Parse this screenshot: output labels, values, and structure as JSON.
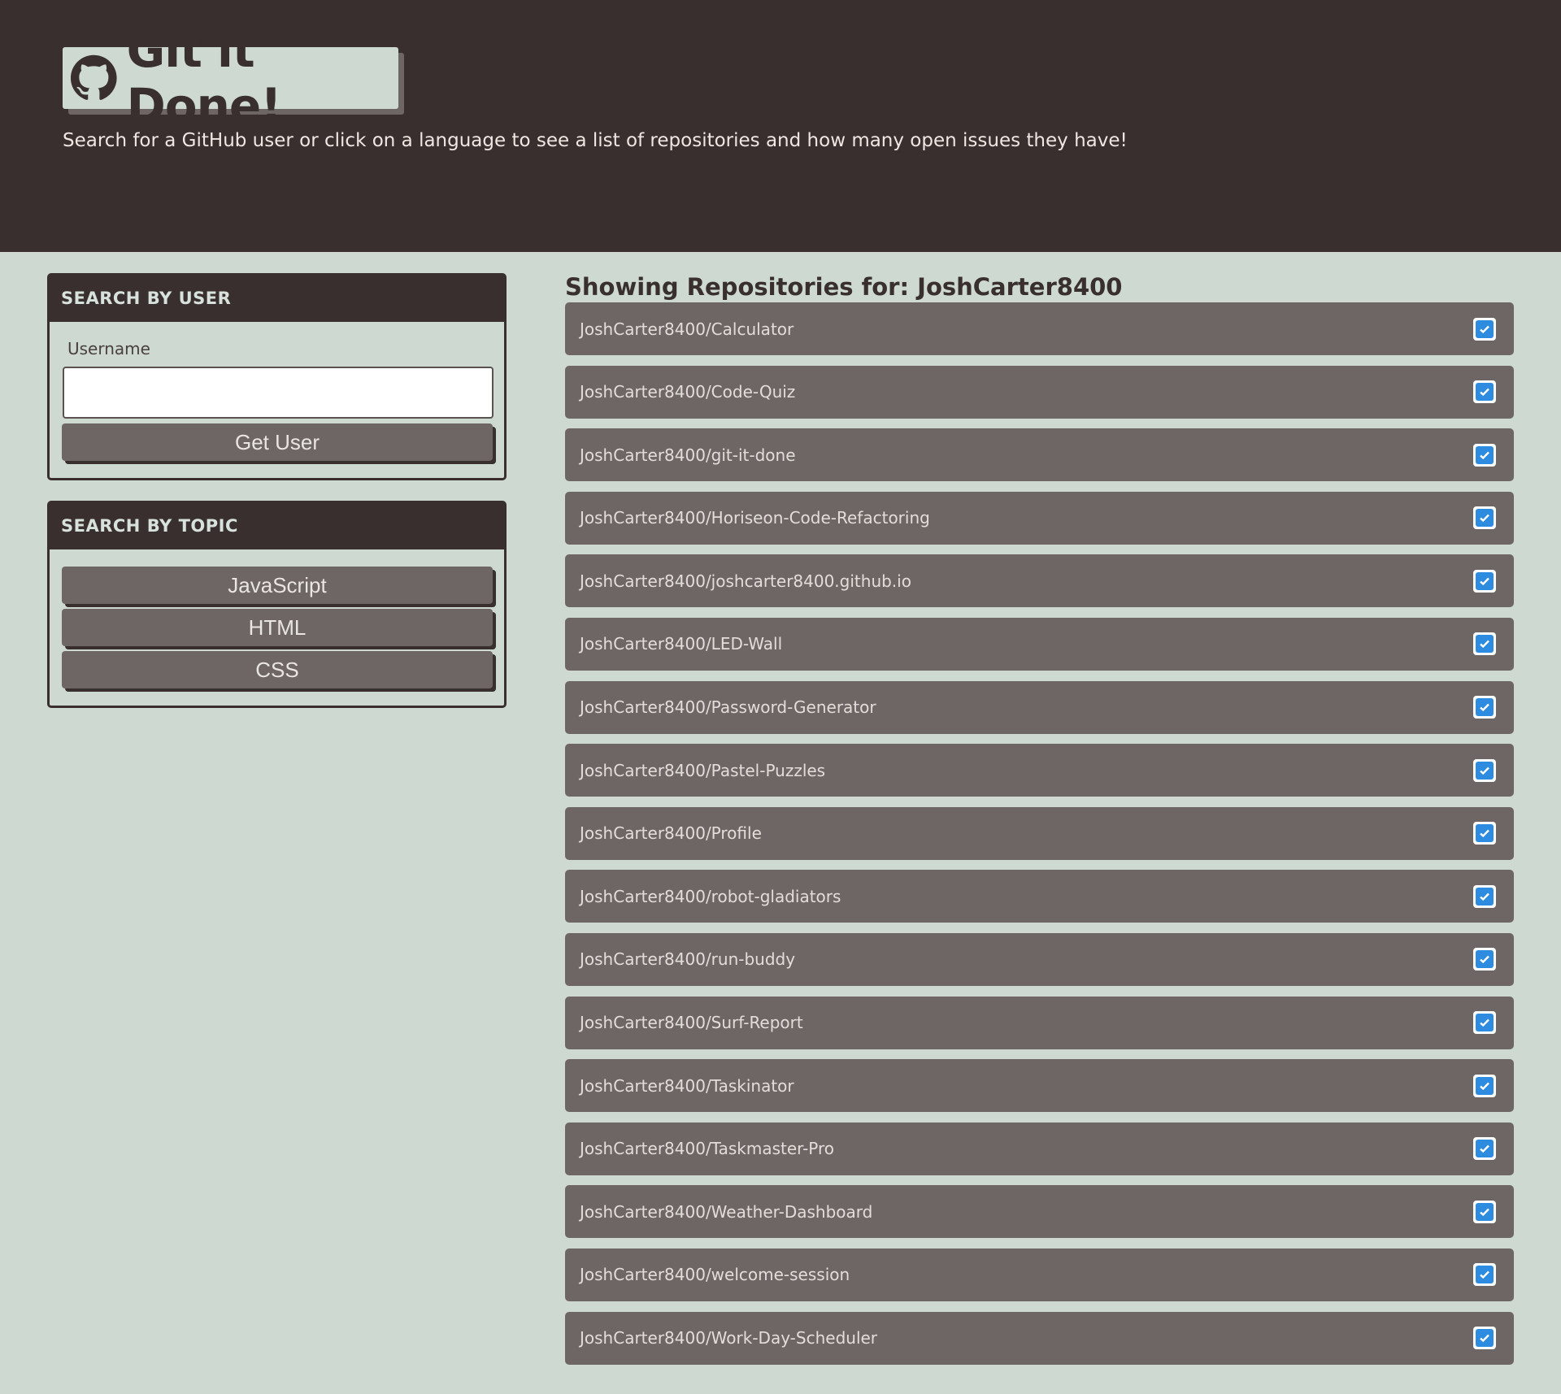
{
  "header": {
    "title": "Git it Done!",
    "subtitle": "Search for a GitHub user or click on a language to see a list of repositories and how many open issues they have!",
    "logo_icon": "github-icon"
  },
  "search_user": {
    "heading": "SEARCH BY USER",
    "label": "Username",
    "input_value": "",
    "button_label": "Get User"
  },
  "search_topic": {
    "heading": "SEARCH BY TOPIC",
    "buttons": [
      "JavaScript",
      "HTML",
      "CSS"
    ]
  },
  "repos": {
    "heading": "Showing Repositories for: JoshCarter8400",
    "items": [
      "JoshCarter8400/Calculator",
      "JoshCarter8400/Code-Quiz",
      "JoshCarter8400/git-it-done",
      "JoshCarter8400/Horiseon-Code-Refactoring",
      "JoshCarter8400/joshcarter8400.github.io",
      "JoshCarter8400/LED-Wall",
      "JoshCarter8400/Password-Generator",
      "JoshCarter8400/Pastel-Puzzles",
      "JoshCarter8400/Profile",
      "JoshCarter8400/robot-gladiators",
      "JoshCarter8400/run-buddy",
      "JoshCarter8400/Surf-Report",
      "JoshCarter8400/Taskinator",
      "JoshCarter8400/Taskmaster-Pro",
      "JoshCarter8400/Weather-Dashboard",
      "JoshCarter8400/welcome-session",
      "JoshCarter8400/Work-Day-Scheduler"
    ],
    "status_icon": "check-square-icon"
  },
  "colors": {
    "header_bg": "#382f2e",
    "page_bg": "#cdd9d1",
    "item_bg": "#6e6664",
    "check_blue": "#2d8be0"
  }
}
